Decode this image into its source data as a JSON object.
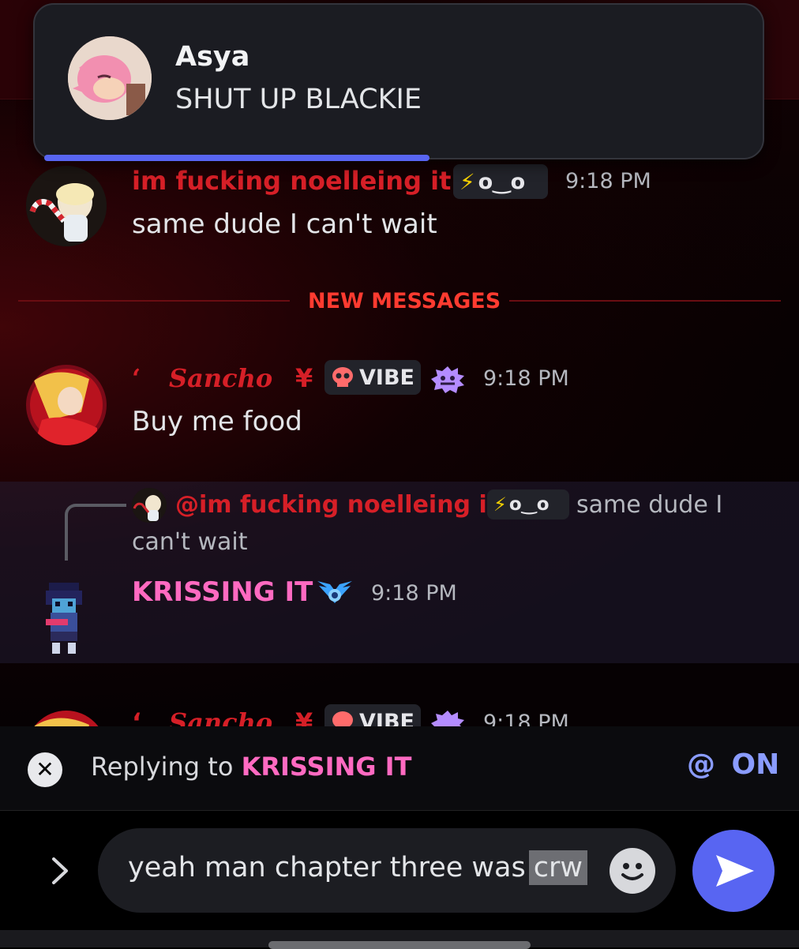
{
  "colors": {
    "accent": "#5865f2",
    "red_name": "#d61f27",
    "pink_name": "#ff6ac1",
    "new_messages": "#ff3b30"
  },
  "notification": {
    "sender": "Asya",
    "message": "SHUT UP BLACKIE"
  },
  "messages": [
    {
      "author": "im fucking noelleing it",
      "tag": "o‿o",
      "tag_icon": "lightning-icon",
      "time": "9:18 PM",
      "text": "same dude I can't wait"
    },
    {
      "author": "Sancho",
      "prefix": "‘",
      "suffix": "¥",
      "tag": "VIBE",
      "tag_icon": "skull-icon",
      "badge_icon": "spiky-face-icon",
      "time": "9:18 PM",
      "text": "Buy me food"
    },
    {
      "reply_to_author": "@im fucking noelleing it",
      "reply_tag": "o‿o",
      "reply_text_line1": "same dude I",
      "reply_text_line2": "can't wait",
      "author": "KRISSING IT",
      "badge_icon": "winged-emblem-icon",
      "time": "9:18 PM"
    },
    {
      "author": "Sancho",
      "prefix": "‘",
      "suffix": "¥",
      "tag": "VIBE",
      "time": "9:18 PM"
    }
  ],
  "divider": {
    "label": "NEW MESSAGES"
  },
  "reply_bar": {
    "prefix": "Replying to",
    "target": "KRISSING IT",
    "mention_symbol": "@",
    "mention_state": "ON"
  },
  "composer": {
    "text_main": "yeah man chapter three was",
    "text_selected": "crw"
  }
}
